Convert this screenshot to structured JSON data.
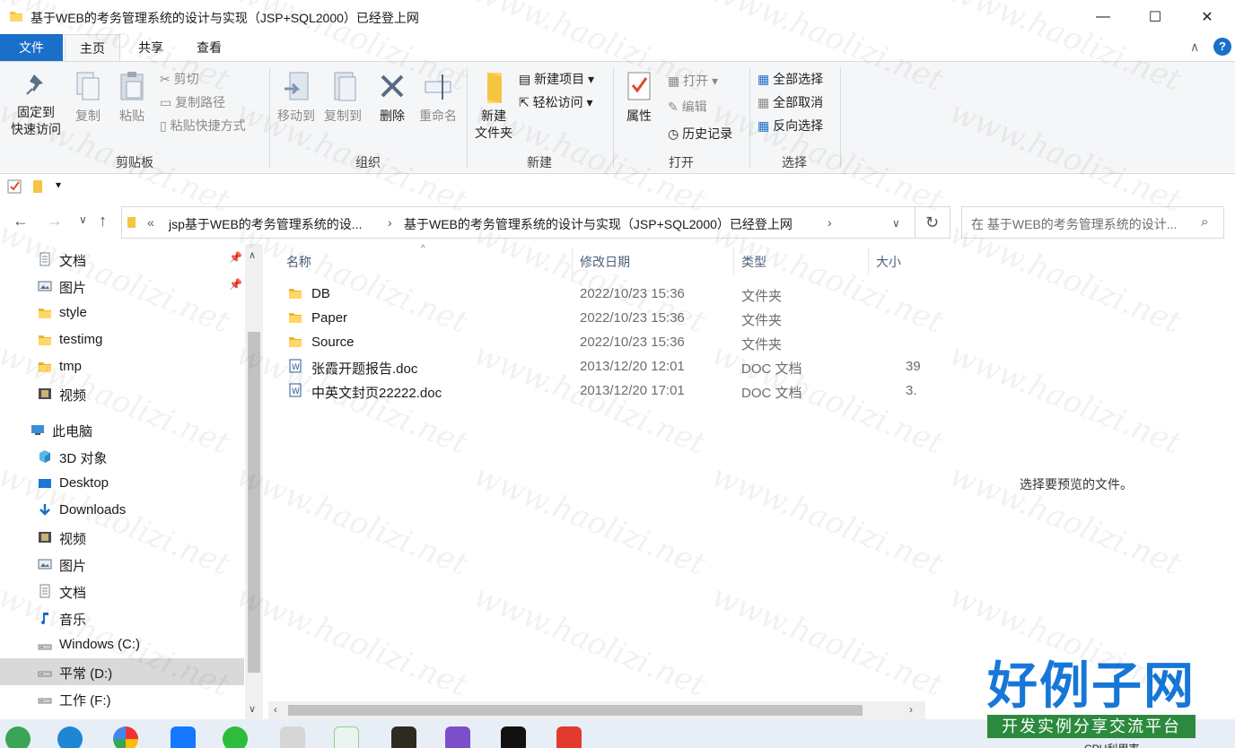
{
  "window": {
    "title": "基于WEB的考务管理系统的设计与实现（JSP+SQL2000）已经登上网",
    "minimize": "—",
    "maximize": "☐",
    "close": "✕"
  },
  "ribbon_tabs": [
    "文件",
    "主页",
    "共享",
    "查看"
  ],
  "ribbon": {
    "clipboard": {
      "pin": [
        "固定到",
        "快速访问"
      ],
      "copy": "复制",
      "paste": "粘贴",
      "cut": "剪切",
      "copy_path": "复制路径",
      "paste_shortcut": "粘贴快捷方式",
      "label": "剪贴板"
    },
    "organize": {
      "move_to": "移动到",
      "copy_to": "复制到",
      "delete": "删除",
      "rename": "重命名",
      "label": "组织"
    },
    "new": {
      "new_folder": [
        "新建",
        "文件夹"
      ],
      "new_item": "新建项目",
      "easy_access": "轻松访问",
      "label": "新建"
    },
    "open": {
      "properties": "属性",
      "open": "打开",
      "edit": "编辑",
      "history": "历史记录",
      "label": "打开"
    },
    "select": {
      "select_all": "全部选择",
      "select_none": "全部取消",
      "invert": "反向选择",
      "label": "选择"
    }
  },
  "address": {
    "overflow": "«",
    "crumb1": "jsp基于WEB的考务管理系统的设...",
    "crumb2": "基于WEB的考务管理系统的设计与实现（JSP+SQL2000）已经登上网",
    "search_placeholder": "在 基于WEB的考务管理系统的设计..."
  },
  "nav": [
    {
      "label": "文档",
      "icon": "document-icon",
      "pinned": true,
      "indent": 1
    },
    {
      "label": "图片",
      "icon": "pictures-icon",
      "pinned": true,
      "indent": 1
    },
    {
      "label": "style",
      "icon": "folder-icon",
      "indent": 1
    },
    {
      "label": "testimg",
      "icon": "folder-icon",
      "indent": 1
    },
    {
      "label": "tmp",
      "icon": "folder-icon",
      "indent": 1
    },
    {
      "label": "视频",
      "icon": "videos-icon",
      "indent": 1
    },
    {
      "label": "此电脑",
      "icon": "this-pc-icon",
      "indent": 0
    },
    {
      "label": "3D 对象",
      "icon": "3d-objects-icon",
      "indent": 1
    },
    {
      "label": "Desktop",
      "icon": "desktop-icon",
      "indent": 1
    },
    {
      "label": "Downloads",
      "icon": "downloads-icon",
      "indent": 1
    },
    {
      "label": "视频",
      "icon": "videos-icon",
      "indent": 1
    },
    {
      "label": "图片",
      "icon": "pictures-icon",
      "indent": 1
    },
    {
      "label": "文档",
      "icon": "document-icon",
      "indent": 1
    },
    {
      "label": "音乐",
      "icon": "music-icon",
      "indent": 1
    },
    {
      "label": "Windows (C:)",
      "icon": "drive-icon",
      "indent": 1
    },
    {
      "label": "平常 (D:)",
      "icon": "drive-icon",
      "indent": 1,
      "selected": true
    },
    {
      "label": "工作 (F:)",
      "icon": "drive-icon",
      "indent": 1
    }
  ],
  "columns": {
    "name": "名称",
    "date": "修改日期",
    "type": "类型",
    "size": "大小"
  },
  "files": [
    {
      "name": "DB",
      "date": "2022/10/23 15:36",
      "type": "文件夹",
      "size": "",
      "icon": "folder-icon"
    },
    {
      "name": "Paper",
      "date": "2022/10/23 15:36",
      "type": "文件夹",
      "size": "",
      "icon": "folder-icon"
    },
    {
      "name": "Source",
      "date": "2022/10/23 15:36",
      "type": "文件夹",
      "size": "",
      "icon": "folder-icon"
    },
    {
      "name": "张霞开题报告.doc",
      "date": "2013/12/20 12:01",
      "type": "DOC 文档",
      "size": "39",
      "icon": "word-doc-icon"
    },
    {
      "name": "中英文封页22222.doc",
      "date": "2013/12/20 17:01",
      "type": "DOC 文档",
      "size": "3.",
      "icon": "word-doc-icon"
    }
  ],
  "preview": {
    "message": "选择要预览的文件。"
  },
  "watermark": {
    "text": "www.haolizi.net"
  },
  "logo": {
    "title": "好例子网",
    "subtitle": "开发实例分享交流平台"
  },
  "taskbar": {
    "cpu_label": "CPU利用率"
  },
  "colors": {
    "accent": "#1a6fc9",
    "folder": "#f5c542",
    "selection": "#d9d9d9"
  }
}
